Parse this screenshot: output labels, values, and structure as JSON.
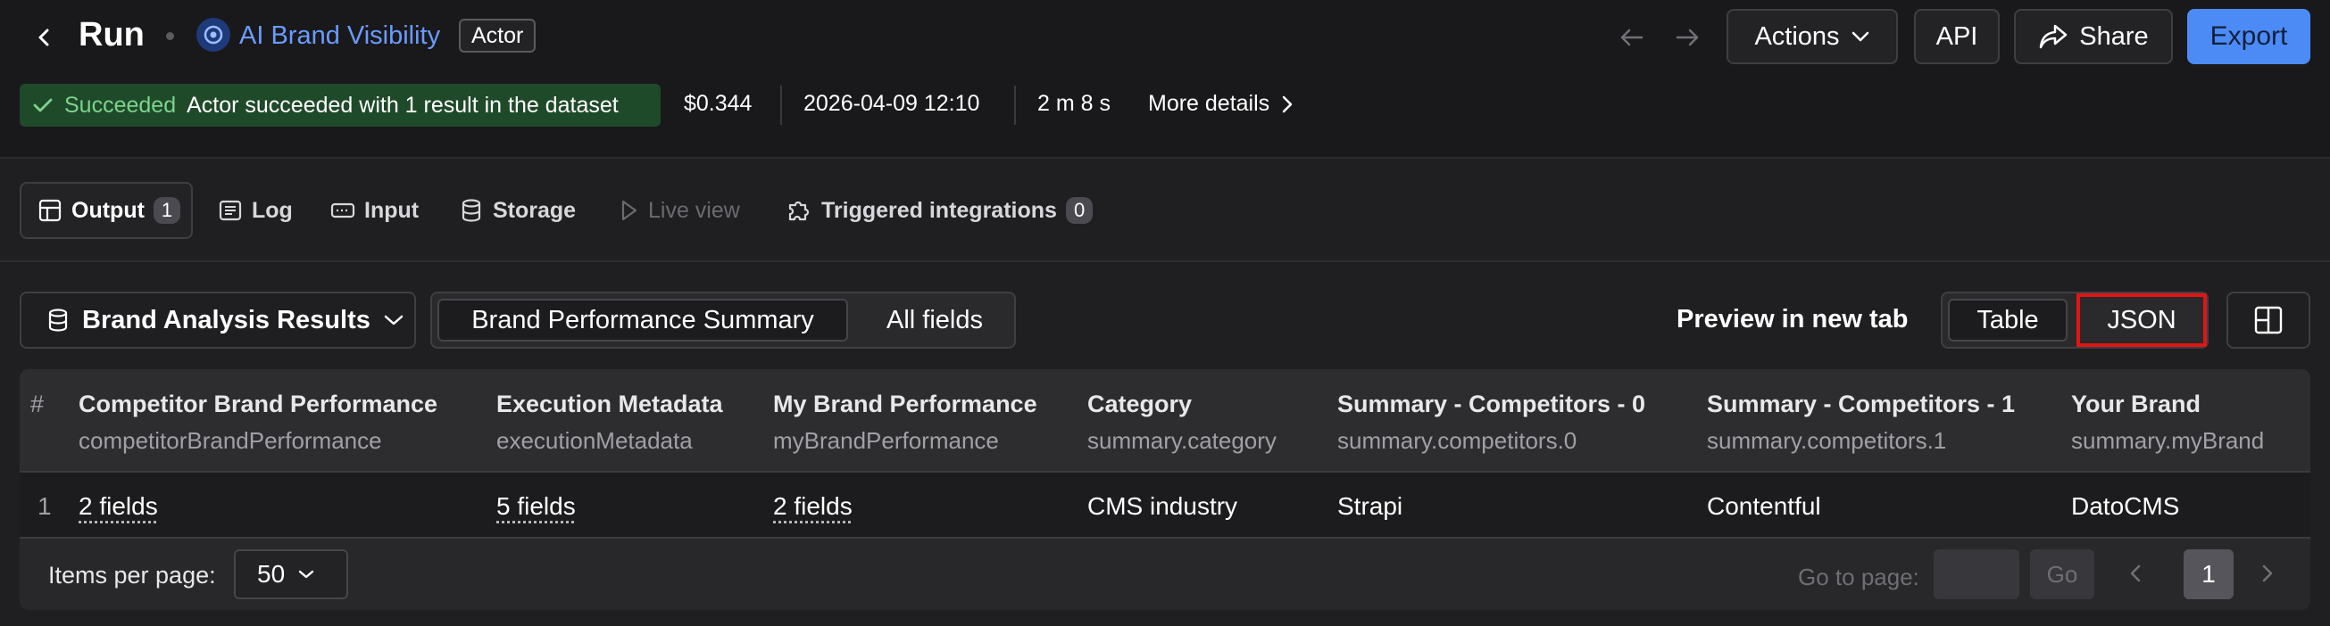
{
  "header": {
    "title": "Run",
    "actor_name": "AI Brand Visibility",
    "actor_badge": "Actor",
    "actions_label": "Actions",
    "api_label": "API",
    "share_label": "Share",
    "export_label": "Export"
  },
  "status": {
    "state": "Succeeded",
    "message": "Actor succeeded with 1 result in the dataset",
    "cost": "$0.344",
    "started": "2026-04-09 12:10",
    "duration": "2 m 8 s",
    "more_details": "More details"
  },
  "tabs": [
    {
      "label": "Output",
      "count": "1",
      "active": true
    },
    {
      "label": "Log"
    },
    {
      "label": "Input"
    },
    {
      "label": "Storage"
    },
    {
      "label": "Live view",
      "disabled": true
    },
    {
      "label": "Triggered integrations",
      "count": "0"
    }
  ],
  "toolbar": {
    "dataset_view": "Brand Analysis Results",
    "segments": [
      "Brand Performance Summary",
      "All fields"
    ],
    "preview_label": "Preview in new tab",
    "view_modes": [
      "Table",
      "JSON"
    ]
  },
  "table": {
    "index_header": "#",
    "columns": [
      {
        "title": "Competitor Brand Performance",
        "key": "competitorBrandPerformance"
      },
      {
        "title": "Execution Metadata",
        "key": "executionMetadata"
      },
      {
        "title": "My Brand Performance",
        "key": "myBrandPerformance"
      },
      {
        "title": "Category",
        "key": "summary.category"
      },
      {
        "title": "Summary - Competitors - 0",
        "key": "summary.competitors.0"
      },
      {
        "title": "Summary - Competitors - 1",
        "key": "summary.competitors.1"
      },
      {
        "title": "Your Brand",
        "key": "summary.myBrand"
      }
    ],
    "rows": [
      {
        "index": "1",
        "cells": [
          "2 fields",
          "5 fields",
          "2 fields",
          "CMS industry",
          "Strapi",
          "Contentful",
          "DatoCMS"
        ]
      }
    ]
  },
  "pagination": {
    "items_per_page_label": "Items per page:",
    "items_per_page": "50",
    "goto_label": "Go to page:",
    "go_label": "Go",
    "current_page": "1"
  },
  "colors": {
    "accent": "#4c8bf5",
    "success_bg": "#1f4a2a",
    "success_text": "#7dd38d",
    "highlight": "#e01515"
  }
}
